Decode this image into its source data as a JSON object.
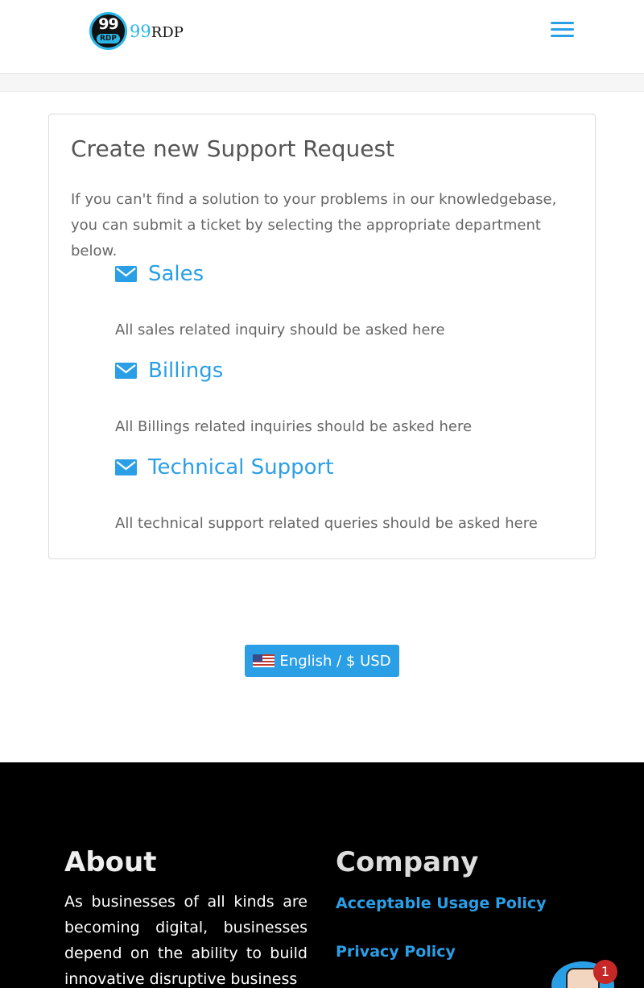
{
  "header": {
    "logo_badge_number": "99",
    "logo_badge_sub": "RDP",
    "logo_text_num": "99",
    "logo_text_brand": "RDP",
    "menu_icon": "hamburger-menu-icon"
  },
  "main": {
    "title": "Create new Support Request",
    "intro": "If you can't find a solution to your problems in our knowledgebase, you can submit a ticket by selecting the appropriate department below.",
    "departments": [
      {
        "name": "Sales",
        "description": "All sales related inquiry should be asked here",
        "icon": "envelope-icon"
      },
      {
        "name": "Billings",
        "description": "All Billings related inquiries should be asked here",
        "icon": "envelope-icon"
      },
      {
        "name": "Technical Support",
        "description": "All technical support related queries should be asked here",
        "icon": "envelope-icon"
      }
    ]
  },
  "language_button": {
    "label": "English / $ USD",
    "icon": "us-flag-icon"
  },
  "footer": {
    "about_title": "About",
    "about_text": "As businesses of all kinds are becoming digital, businesses depend on the ability to build innovative disruptive business",
    "company_title": "Company",
    "links": [
      "Acceptable Usage Policy",
      "Privacy Policy"
    ]
  },
  "chat": {
    "badge_count": "1",
    "icon": "chat-avatar-icon"
  },
  "colors": {
    "accent": "#2b9fe6",
    "logo_cyan": "#2ab6e9",
    "footer_bg": "#000000",
    "badge_red": "#c62828"
  }
}
